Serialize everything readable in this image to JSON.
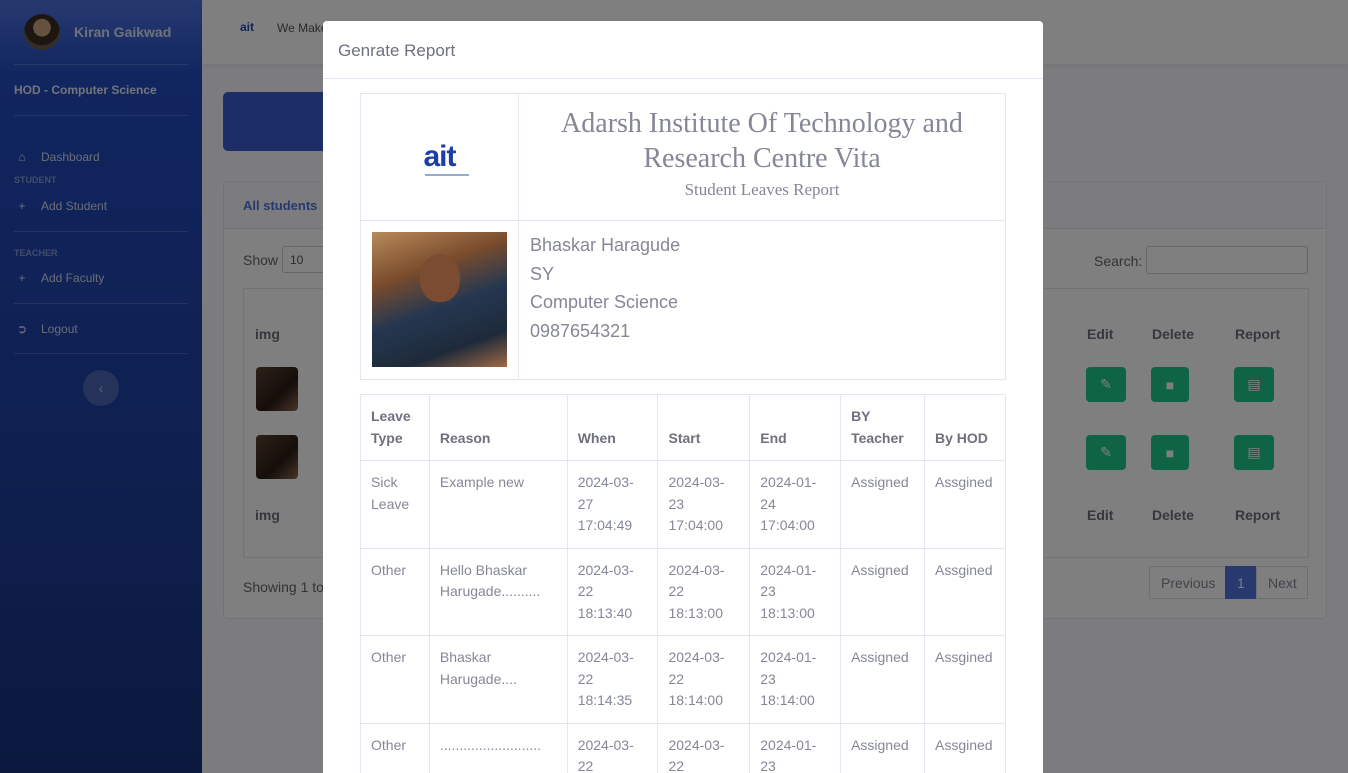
{
  "sidebar": {
    "user_name": "Kiran Gaikwad",
    "department": "HOD - Computer Science",
    "items": [
      {
        "label": "Dashboard",
        "icon": "home-icon"
      },
      {
        "label": "Add Student",
        "icon": "plus-icon"
      },
      {
        "label": "Add Faculty",
        "icon": "plus-icon"
      },
      {
        "label": "Logout",
        "icon": "logout-icon"
      }
    ],
    "headings": {
      "student": "STUDENT",
      "teacher": "TEACHER"
    }
  },
  "topbar": {
    "logo": "ait",
    "text": "We Make"
  },
  "background": {
    "card_title": "All students",
    "show_label": "Show",
    "show_value": "10",
    "search_label": "Search:",
    "columns": {
      "img": "img",
      "edit": "Edit",
      "delete": "Delete",
      "report": "Report"
    },
    "showing_text": "Showing 1 to",
    "pager": {
      "previous": "Previous",
      "page": "1",
      "next": "Next"
    }
  },
  "modal": {
    "title": "Genrate Report",
    "logo_text": "ait",
    "institute": "Adarsh Institute Of Technology and Research Centre Vita",
    "report_title": "Student Leaves Report",
    "student": {
      "name": "Bhaskar Haragude",
      "year": "SY",
      "department": "Computer Science",
      "phone": "0987654321"
    },
    "table": {
      "headers": [
        "Leave Type",
        "Reason",
        "When",
        "Start",
        "End",
        "BY Teacher",
        "By HOD"
      ],
      "rows": [
        [
          "Sick Leave",
          "Example new",
          "2024-03-27 17:04:49",
          "2024-03-23 17:04:00",
          "2024-01-24 17:04:00",
          "Assigned",
          "Assgined"
        ],
        [
          "Other",
          "Hello Bhaskar Harugade..........",
          "2024-03-22 18:13:40",
          "2024-03-22 18:13:00",
          "2024-01-23 18:13:00",
          "Assigned",
          "Assgined"
        ],
        [
          "Other",
          "Bhaskar Harugade....",
          "2024-03-22 18:14:35",
          "2024-03-22 18:14:00",
          "2024-01-23 18:14:00",
          "Assigned",
          "Assgined"
        ],
        [
          "Other",
          "..........................",
          "2024-03-22",
          "2024-03-22",
          "2024-01-23",
          "Assigned",
          "Assgined"
        ]
      ]
    }
  }
}
